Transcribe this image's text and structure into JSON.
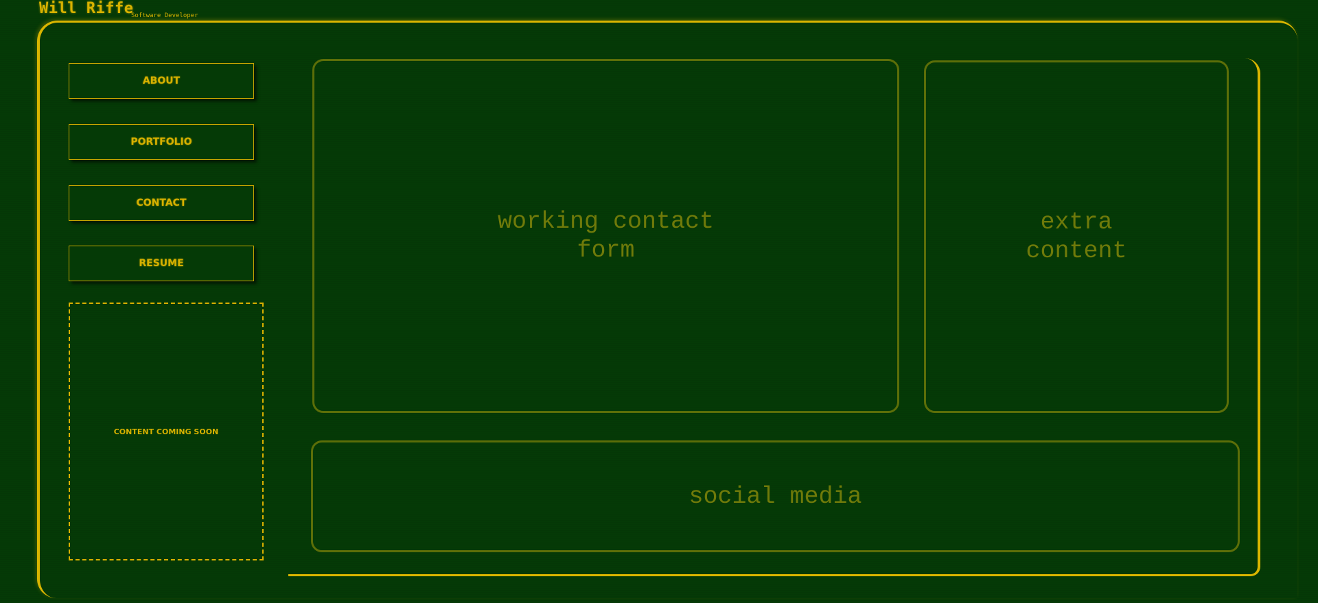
{
  "header": {
    "name": "Will Riffe",
    "subtitle": "Software Developer"
  },
  "nav": {
    "items": [
      {
        "label": "ABOUT"
      },
      {
        "label": "PORTFOLIO"
      },
      {
        "label": "CONTACT"
      },
      {
        "label": "RESUME"
      }
    ]
  },
  "sidebar": {
    "placeholder": "CONTENT COMING SOON"
  },
  "main": {
    "contact_panel": "working contact\nform",
    "extra_panel": "extra\ncontent",
    "social_panel": "social media"
  },
  "colors": {
    "background": "#053a06",
    "accent": "#d9b500",
    "muted": "#6f7a0a"
  }
}
